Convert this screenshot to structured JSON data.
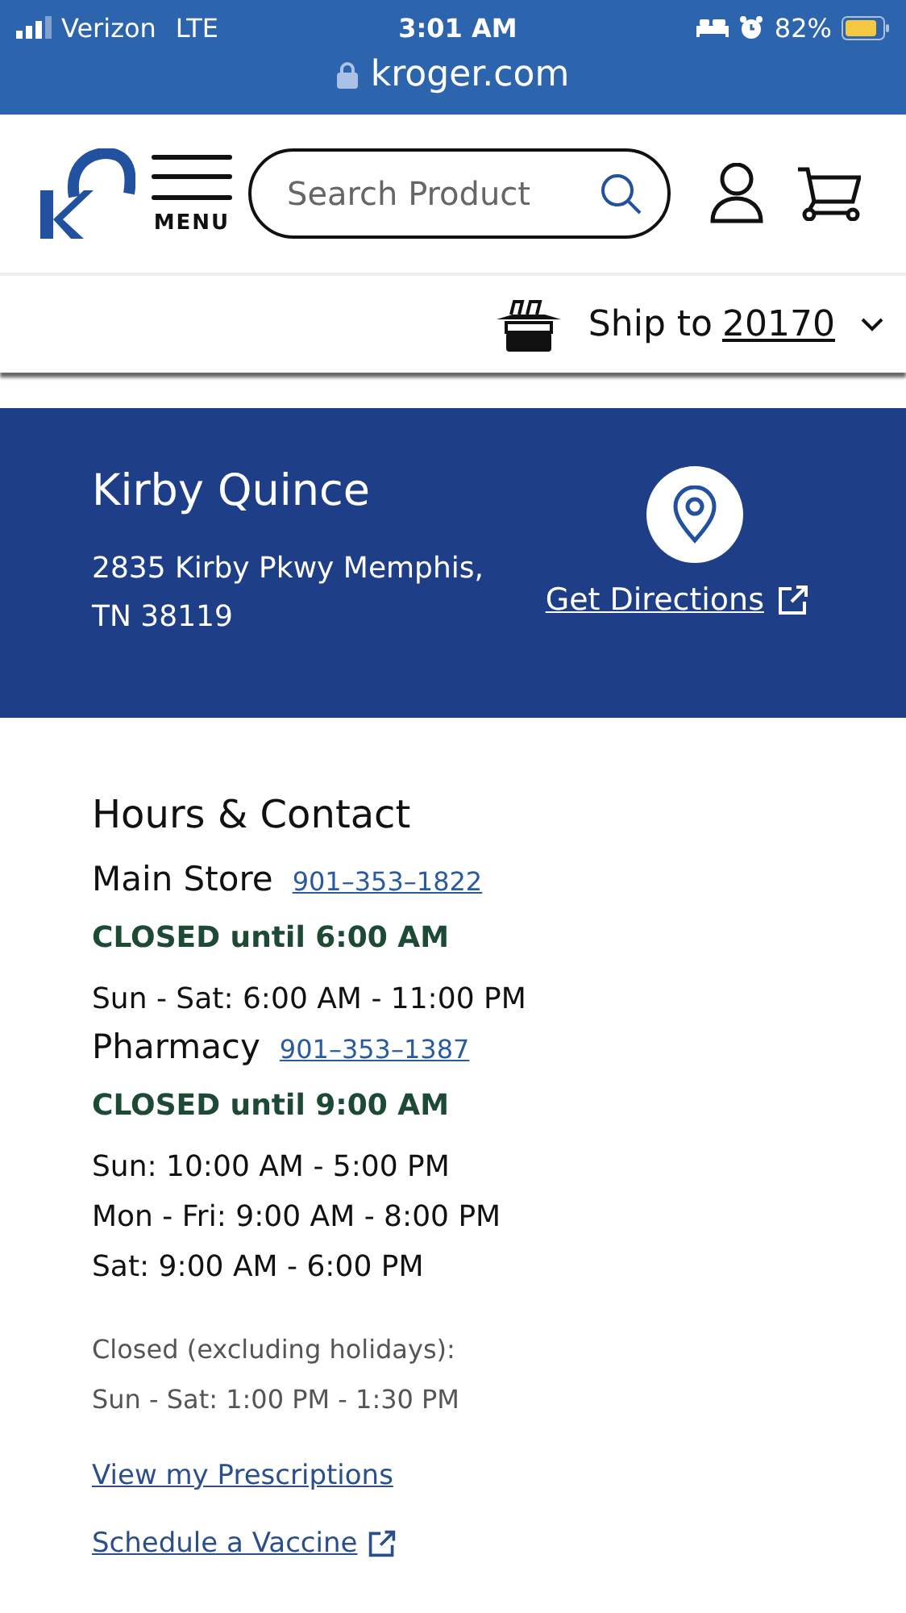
{
  "status_bar": {
    "carrier": "Verizon",
    "network": "LTE",
    "time": "3:01 AM",
    "battery": "82%"
  },
  "address_bar": {
    "url": "kroger.com"
  },
  "header": {
    "menu_label": "MENU",
    "search": {
      "placeholder": "Search Product"
    }
  },
  "ship_bar": {
    "label": "Ship to",
    "zip": "20170"
  },
  "store": {
    "name": "Kirby Quince",
    "address": [
      "2835 Kirby Pkwy Memphis,",
      "TN 38119"
    ],
    "directions": "Get Directions"
  },
  "hours": {
    "title": "Hours & Contact",
    "sections": [
      {
        "name": "Main Store",
        "phone": "901–353–1822",
        "status": "CLOSED until 6:00 AM",
        "hours": [
          "Sun - Sat: 6:00 AM - 11:00 PM"
        ]
      },
      {
        "name": "Pharmacy",
        "phone": "901–353–1387",
        "status": "CLOSED until 9:00 AM",
        "hours": [
          "Sun: 10:00 AM - 5:00 PM",
          "Mon - Fri: 9:00 AM - 8:00 PM",
          "Sat: 9:00 AM - 6:00 PM"
        ]
      }
    ],
    "closed_note": [
      "Closed (excluding holidays):",
      "Sun - Sat: 1:00 PM - 1:30 PM"
    ]
  },
  "links": [
    {
      "label": "View my Prescriptions",
      "external": false
    },
    {
      "label": "Schedule a Vaccine",
      "external": true
    }
  ]
}
